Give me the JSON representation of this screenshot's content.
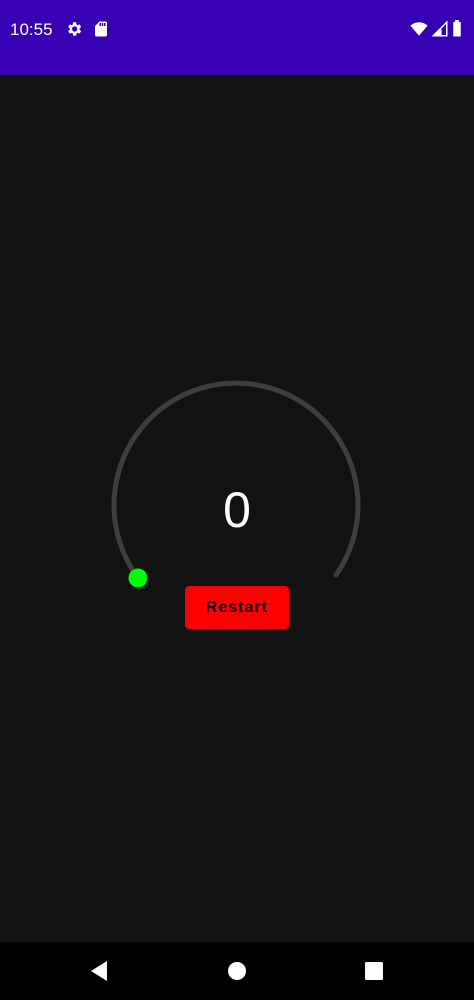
{
  "status_bar": {
    "time": "10:55",
    "background": "#3700b3",
    "icons": [
      "settings-icon",
      "sd-card-icon",
      "wifi-icon",
      "signal-icon",
      "battery-icon"
    ]
  },
  "timer": {
    "value": "0",
    "track_color": "#3e3e3e",
    "indicator_color": "#00ff00",
    "progress": 0
  },
  "restart_button": {
    "label": "Restart",
    "color": "#ff0000"
  },
  "nav_bar": {
    "icons": [
      "back-icon",
      "home-icon",
      "recents-icon"
    ]
  },
  "theme": {
    "background": "#121212"
  }
}
